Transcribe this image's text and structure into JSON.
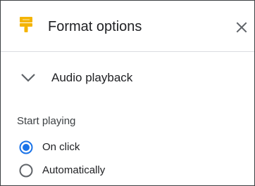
{
  "header": {
    "icon": "paint-roller-icon",
    "icon_color": "#f4b400",
    "title": "Format options",
    "close_icon": "close-icon"
  },
  "section": {
    "expanded": true,
    "chevron_icon": "chevron-down-icon",
    "title": "Audio playback"
  },
  "start_playing": {
    "label": "Start playing",
    "options": [
      {
        "label": "On click",
        "selected": true
      },
      {
        "label": "Automatically",
        "selected": false
      }
    ]
  },
  "colors": {
    "accent": "#1a73e8",
    "text": "#202124",
    "secondary_text": "#3c4043",
    "divider": "#dadce0",
    "border": "#3c4043"
  }
}
